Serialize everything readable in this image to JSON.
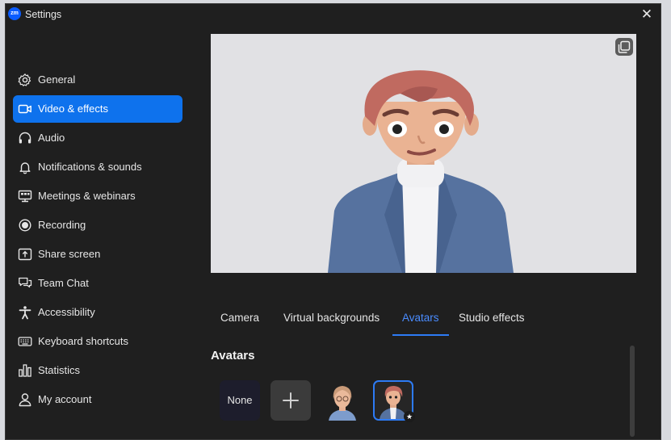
{
  "window": {
    "title": "Settings",
    "app_logo_text": "zm",
    "close_glyph": "✕"
  },
  "sidebar": {
    "items": [
      {
        "label": "General",
        "icon": "gear-icon"
      },
      {
        "label": "Video & effects",
        "icon": "video-camera-icon",
        "active": true
      },
      {
        "label": "Audio",
        "icon": "headphones-icon"
      },
      {
        "label": "Notifications & sounds",
        "icon": "bell-icon"
      },
      {
        "label": "Meetings & webinars",
        "icon": "meetings-icon"
      },
      {
        "label": "Recording",
        "icon": "record-icon"
      },
      {
        "label": "Share screen",
        "icon": "share-screen-icon"
      },
      {
        "label": "Team Chat",
        "icon": "chat-icon"
      },
      {
        "label": "Accessibility",
        "icon": "accessibility-icon"
      },
      {
        "label": "Keyboard shortcuts",
        "icon": "keyboard-icon"
      },
      {
        "label": "Statistics",
        "icon": "statistics-icon"
      },
      {
        "label": "My account",
        "icon": "person-icon"
      }
    ]
  },
  "preview": {
    "pip_icon": "picture-in-picture-icon"
  },
  "tabs": {
    "items": [
      {
        "label": "Camera"
      },
      {
        "label": "Virtual backgrounds"
      },
      {
        "label": "Avatars",
        "active": true
      },
      {
        "label": "Studio effects"
      }
    ]
  },
  "avatars": {
    "section_title": "Avatars",
    "none_label": "None",
    "add_icon": "plus-icon",
    "selected_index": 1
  },
  "colors": {
    "accent": "#0e72ed",
    "background": "#1f1f1f",
    "tab_active": "#4a8cff"
  }
}
